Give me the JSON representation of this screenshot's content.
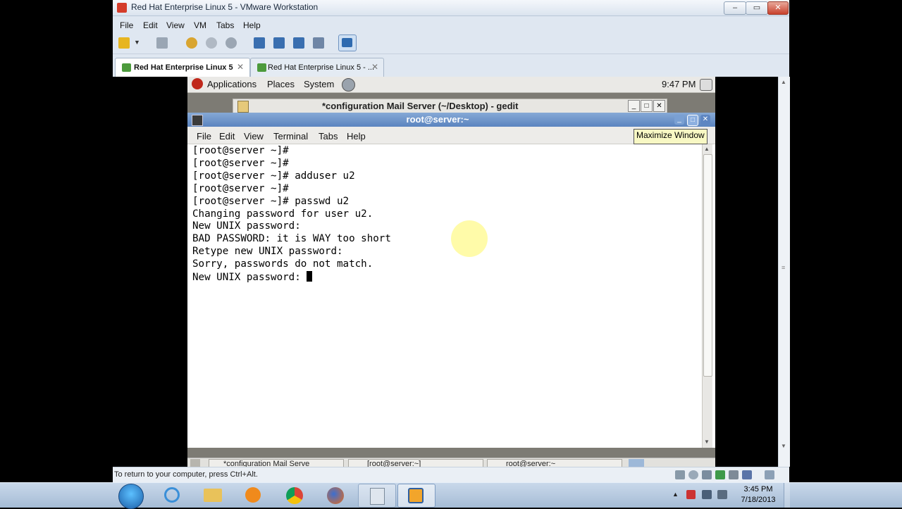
{
  "vmware": {
    "title": "Red Hat Enterprise Linux 5 - VMware Workstation",
    "menu": [
      "File",
      "Edit",
      "View",
      "VM",
      "Tabs",
      "Help"
    ],
    "tabs": [
      {
        "label": "Red Hat Enterprise Linux 5",
        "close": "✕",
        "active": true
      },
      {
        "label": "Red Hat Enterprise Linux 5 - ...",
        "close": "✕",
        "active": false
      }
    ],
    "status": "To return to your computer, press Ctrl+Alt.",
    "window_buttons": {
      "minimize": "–",
      "maximize": "▭",
      "close": "✕"
    }
  },
  "guest": {
    "panel": {
      "applications": "Applications",
      "places": "Places",
      "system": "System",
      "time": "9:47 PM"
    },
    "gedit_title": "*configuration Mail Server (~/Desktop) - gedit",
    "terminal": {
      "title": "root@server:~",
      "menu": [
        "File",
        "Edit",
        "View",
        "Terminal",
        "Tabs",
        "Help"
      ],
      "lines": [
        "[root@server ~]#",
        "[root@server ~]#",
        "[root@server ~]# adduser u2",
        "[root@server ~]#",
        "[root@server ~]# passwd u2",
        "Changing password for user u2.",
        "New UNIX password:",
        "BAD PASSWORD: it is WAY too short",
        "Retype new UNIX password:",
        "Sorry, passwords do not match.",
        "New UNIX password: "
      ]
    },
    "tooltip": "Maximize Window",
    "taskbar": [
      "*configuration Mail Serve",
      "[root@server:~]",
      "root@server:~"
    ]
  },
  "windows_taskbar": {
    "time": "3:45 PM",
    "date": "7/18/2013"
  },
  "colors": {
    "terminal_titlebar": "#6a92c9",
    "vm_close": "#c8412c",
    "accent": "#1b5ea8"
  }
}
